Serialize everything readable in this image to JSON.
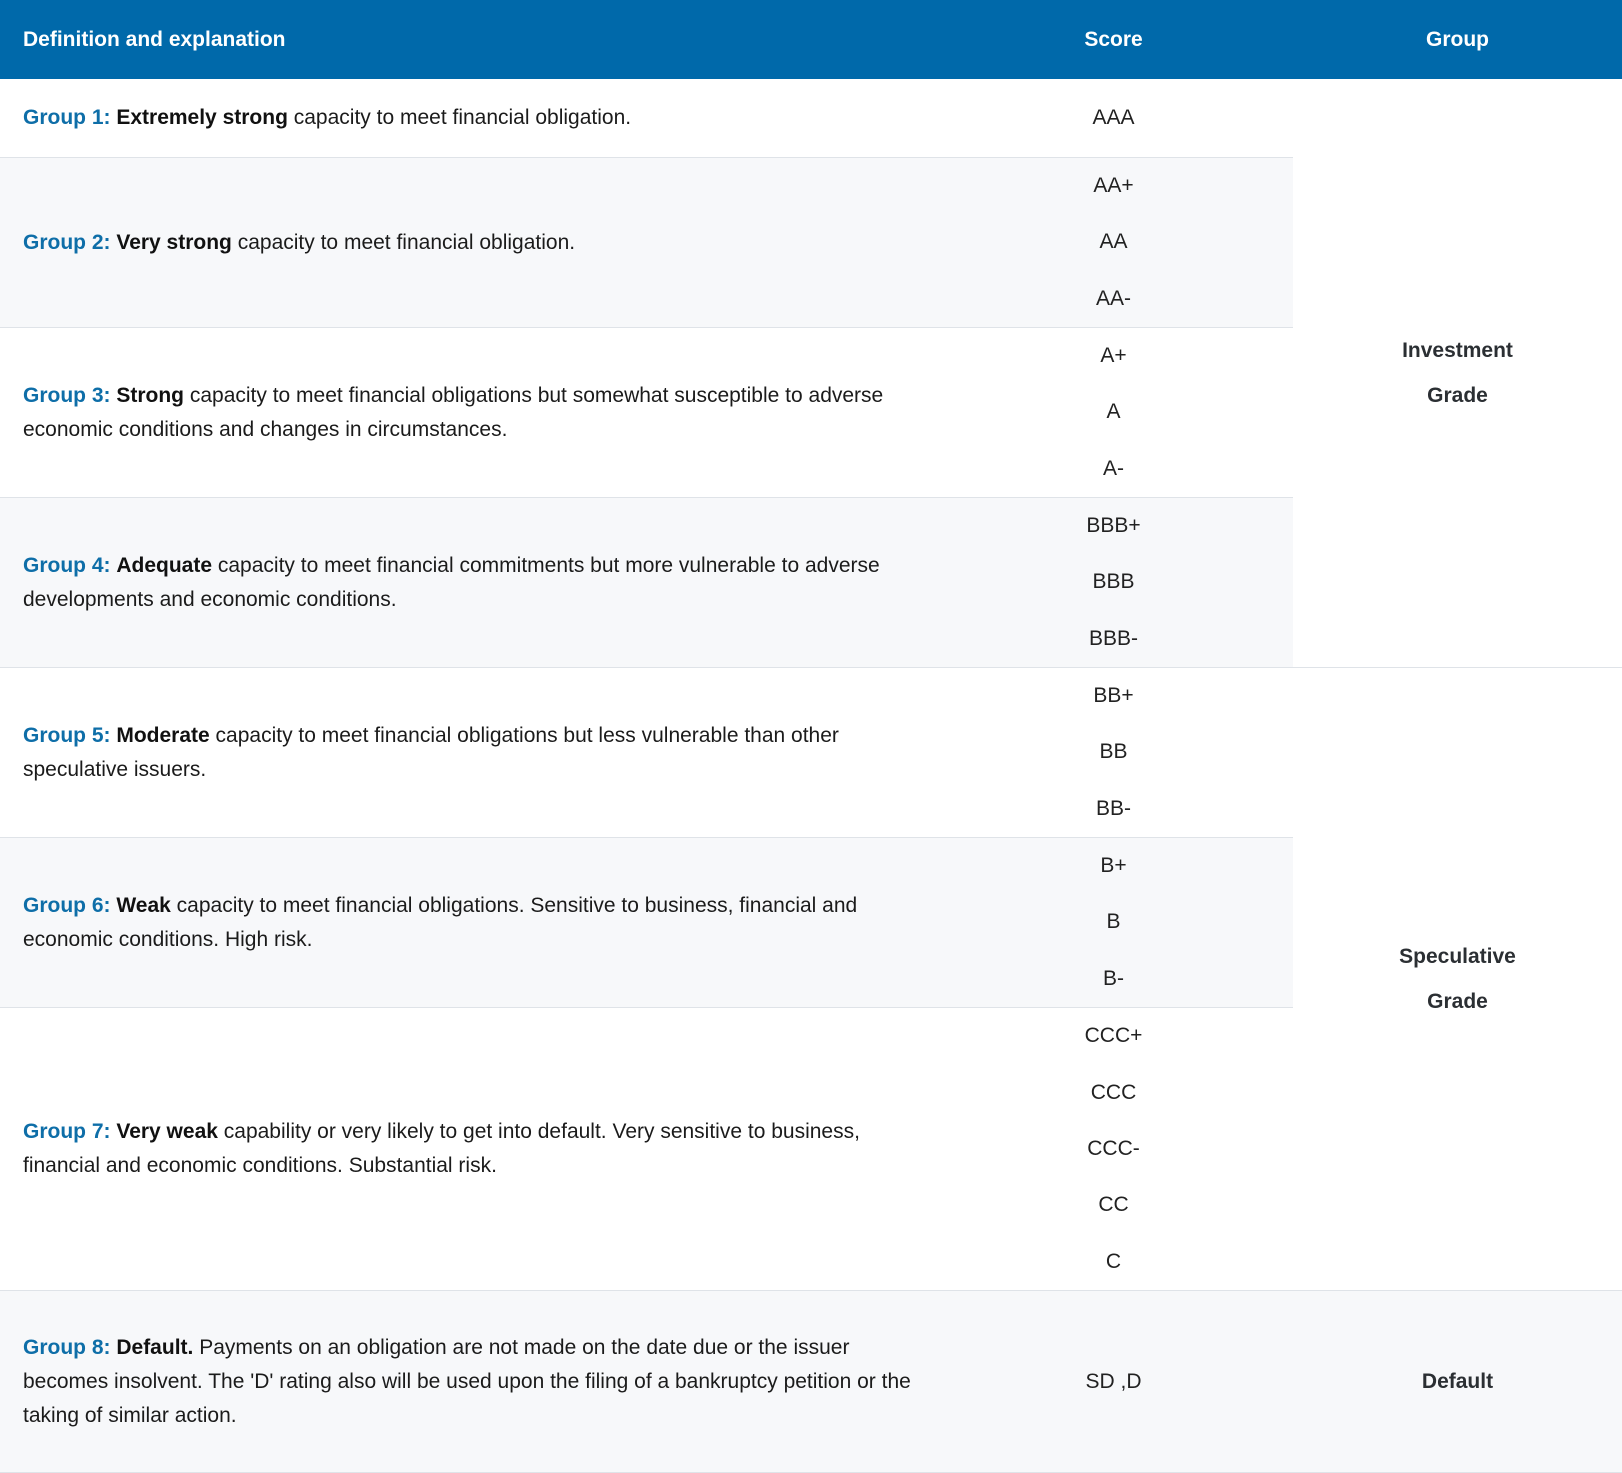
{
  "header": {
    "definition": "Definition and explanation",
    "score": "Score",
    "group": "Group"
  },
  "rows": [
    {
      "label": "Group 1:",
      "strong": "Extremely strong",
      "text": " capacity to meet financial obligation.",
      "scores": [
        "AAA"
      ]
    },
    {
      "label": "Group 2:",
      "strong": "Very strong",
      "text": " capacity to meet financial obligation.",
      "scores": [
        "AA+",
        "AA",
        "AA-"
      ]
    },
    {
      "label": "Group 3:",
      "strong": "Strong",
      "text": " capacity to meet financial obligations but somewhat susceptible to adverse economic conditions and changes in circumstances.",
      "scores": [
        "A+",
        "A",
        "A-"
      ]
    },
    {
      "label": "Group 4:",
      "strong": "Adequate",
      "text": " capacity to meet financial commitments but more vulnerable to adverse developments and economic conditions.",
      "scores": [
        "BBB+",
        "BBB",
        "BBB-"
      ]
    },
    {
      "label": "Group 5:",
      "strong": "Moderate",
      "text": " capacity to meet financial obligations but less vulnerable than other speculative issuers.",
      "scores": [
        "BB+",
        "BB",
        "BB-"
      ]
    },
    {
      "label": "Group 6:",
      "strong": "Weak",
      "text": " capacity to meet financial obligations. Sensitive to business, financial and economic conditions. High risk.",
      "scores": [
        "B+",
        "B",
        "B-"
      ]
    },
    {
      "label": "Group 7:",
      "strong": "Very weak",
      "text": " capability or very likely to get into default. Very sensitive to business, financial and economic conditions. Substantial risk.",
      "scores": [
        "CCC+",
        "CCC",
        "CCC-",
        "CC",
        "C"
      ]
    },
    {
      "label": "Group 8:",
      "strong": "Default.",
      "text": " Payments on an obligation are not made on the date due or the issuer becomes insolvent. The 'D' rating also will be used upon the filing of a bankruptcy petition or the taking of similar action.",
      "scores": [
        "SD ,D"
      ]
    }
  ],
  "groups": [
    {
      "line1": "Investment",
      "line2": "Grade"
    },
    {
      "line1": "Speculative",
      "line2": "Grade"
    },
    {
      "line1": "Default",
      "line2": ""
    }
  ]
}
